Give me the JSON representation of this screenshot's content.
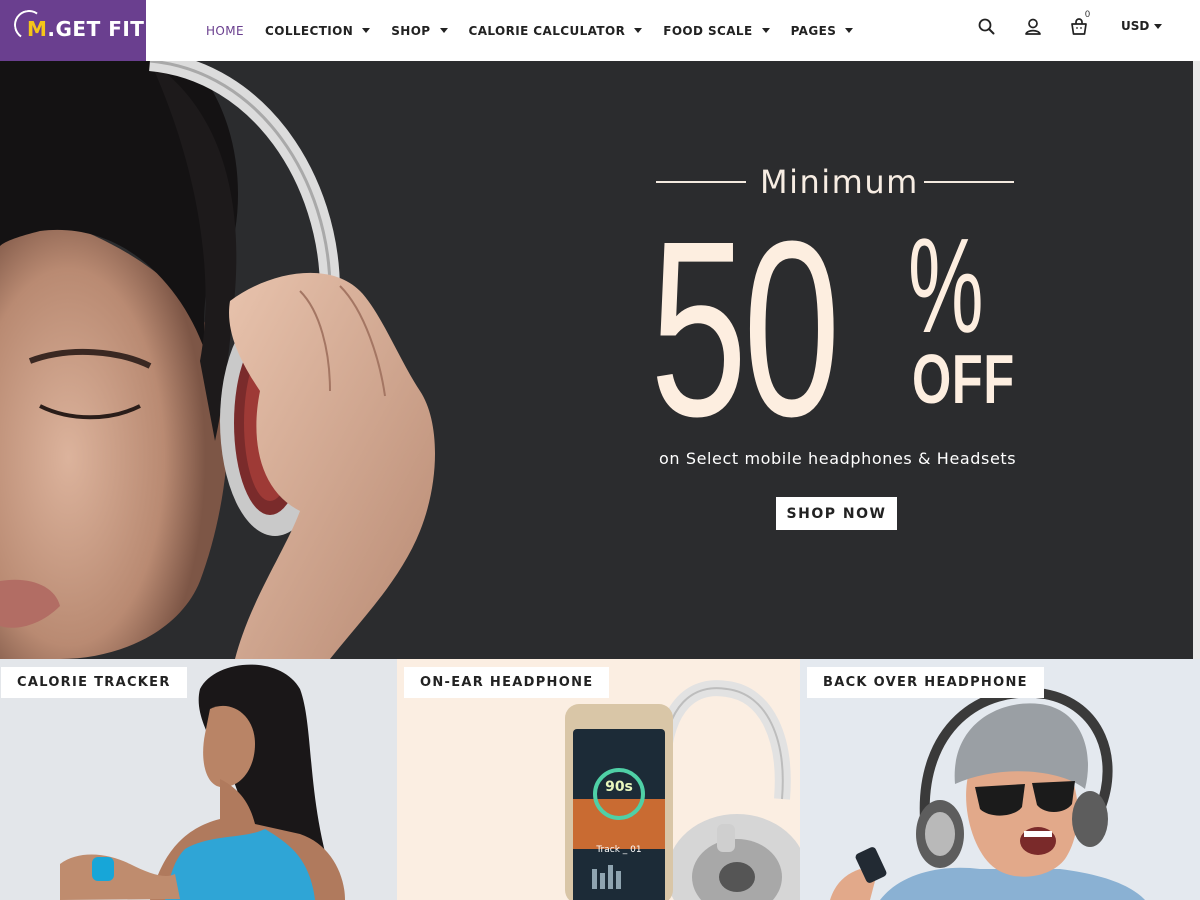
{
  "header": {
    "logo_m": "M",
    "logo_text": ".GET FIT",
    "nav": [
      {
        "label": "HOME",
        "active": true,
        "has_dropdown": false
      },
      {
        "label": "COLLECTION",
        "has_dropdown": true
      },
      {
        "label": "SHOP",
        "has_dropdown": true
      },
      {
        "label": "CALORIE CALCULATOR",
        "has_dropdown": true
      },
      {
        "label": "FOOD SCALE",
        "has_dropdown": true
      },
      {
        "label": "PAGES",
        "has_dropdown": true
      }
    ],
    "icons": [
      "search-icon",
      "user-icon",
      "cart-icon"
    ],
    "cart_count": "0",
    "currency": "USD"
  },
  "hero": {
    "minimum": "Minimum",
    "discount_number": "50",
    "percent": "%",
    "off": "OFF",
    "subtitle": "on Select mobile headphones & Headsets",
    "cta": "SHOP NOW"
  },
  "categories": [
    {
      "label": "CALORIE TRACKER"
    },
    {
      "label": "ON-EAR HEADPHONE"
    },
    {
      "label": "BACK OVER HEADPHONE"
    }
  ],
  "phone_screen": {
    "counter": "90s",
    "track": "Track _ 01"
  },
  "colors": {
    "brand_purple": "#6a3f8f",
    "logo_accent": "#f5c518",
    "hero_bg": "#2b2c2e",
    "hero_text": "#fdeee0"
  }
}
